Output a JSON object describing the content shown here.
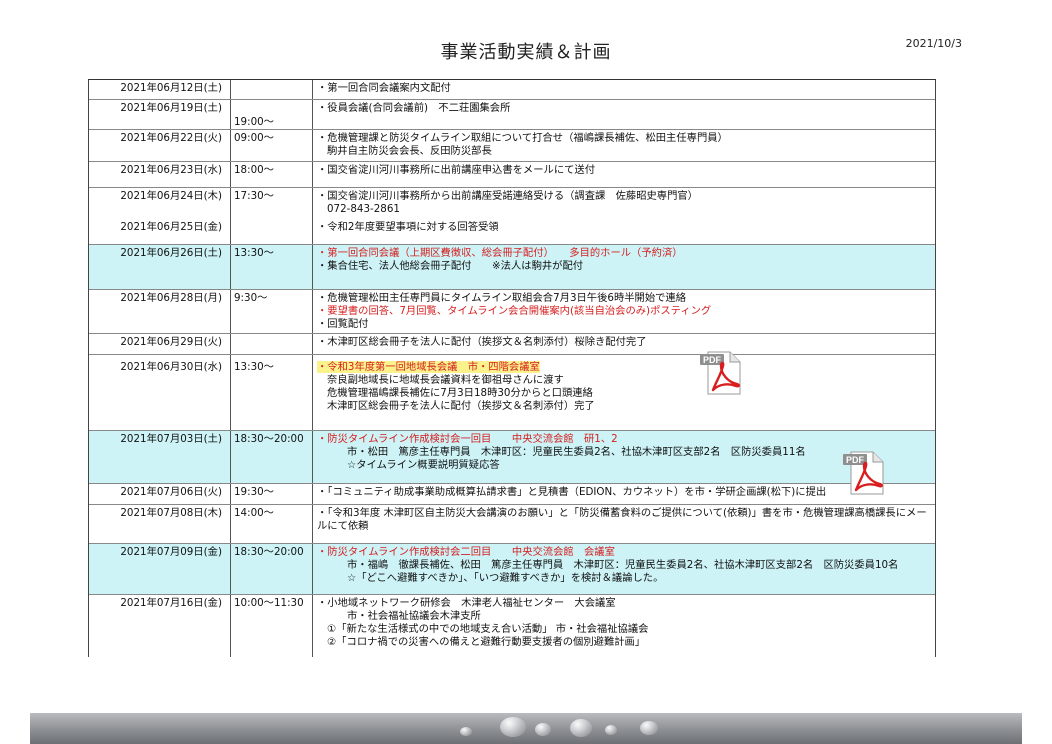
{
  "header": {
    "title": "事業活動実績＆計画",
    "date": "2021/10/3"
  },
  "rows": [
    {
      "date": "2021年06月12日(土)",
      "time": "",
      "lines": [
        "・第一回合同会議案内文配付"
      ]
    },
    {
      "date": "2021年06月19日(土)",
      "time": "19:00～",
      "lines": [
        "・役員会議(合同会議前)　不二荘園集会所"
      ]
    },
    {
      "date": "2021年06月22日(火)",
      "time": "09:00～",
      "lines": [
        "・危機管理課と防災タイムライン取組について打合せ（福嶋課長補佐、松田主任専門員）",
        "駒井自主防災会会長、反田防災部長"
      ]
    },
    {
      "date": "2021年06月23日(水)",
      "time": "18:00～",
      "lines": [
        "・国交省淀川河川事務所に出前講座申込書をメールにて送付"
      ]
    },
    {
      "date": "2021年06月24日(木)",
      "time": "17:30～",
      "lines": [
        "・国交省淀川河川事務所から出前講座受諾連絡受ける（調査課　佐藤昭史専門官）",
        "072-843-2861"
      ]
    },
    {
      "date": "2021年06月25日(金)",
      "time": "",
      "lines": [
        "・令和2年度要望事項に対する回答受領"
      ]
    },
    {
      "date": "2021年06月26日(土)",
      "time": "13:30～",
      "lines": [
        "・第一回合同会議（上期区費徴収、総会冊子配付）　　多目的ホール（予約済）",
        "・集合住宅、法人他総会冊子配付　　※法人は駒井が配付"
      ]
    },
    {
      "date": "2021年06月28日(月)",
      "time": "9:30～",
      "lines": [
        "・危機管理松田主任専門員にタイムライン取組会合7月3日午後6時半開始で連絡",
        "・要望書の回答、7月回覧、タイムライン会合開催案内(該当自治会のみ)ポスティング",
        "・回覧配付"
      ]
    },
    {
      "date": "2021年06月29日(火)",
      "time": "",
      "lines": [
        "・木津町区総会冊子を法人に配付（挨拶文＆名刺添付）桜除き配付完了"
      ]
    },
    {
      "date": "2021年06月30日(水)",
      "time": "13:30～",
      "lines": [
        "・令和3年度第一回地域長会議　市・四階会議室",
        "奈良副地域長に地域長会議資料を御祖母さんに渡す",
        "危機管理福嶋課長補佐に7月3日18時30分からと口頭連絡",
        "木津町区総会冊子を法人に配付（挨拶文＆名刺添付）完了"
      ]
    },
    {
      "date": "2021年07月03日(土)",
      "time": "18:30～20:00",
      "lines": [
        "・防災タイムライン作成検討会一回目　　中央交流会館　研1、2",
        "市・松田　篤彦主任専門員　木津町区：児童民生委員2名、社協木津町区支部2名　区防災委員11名",
        "☆タイムライン概要説明質疑応答"
      ]
    },
    {
      "date": "2021年07月06日(火)",
      "time": "19:30～",
      "lines": [
        "・「コミュニティ助成事業助成概算払請求書」と見積書（EDION、カウネット）を市・学研企画課(松下)に提出"
      ]
    },
    {
      "date": "2021年07月08日(木)",
      "time": "14:00～",
      "lines": [
        "・「令和3年度 木津町区自主防災大会講演のお願い」と「防災備蓄食料のご提供について(依頼)」書を市・危機管理課高橋課長にメールにて依頼"
      ]
    },
    {
      "date": "2021年07月09日(金)",
      "time": "18:30～20:00",
      "lines": [
        "・防災タイムライン作成検討会二回目　　中央交流会館　会議室",
        "市・福嶋　徹課長補佐、松田　篤彦主任専門員　木津町区：児童民生委員2名、社協木津町区支部2名　区防災委員10名",
        "☆「どこへ避難すべきか」、「いつ避難すべきか」を検討＆議論した。"
      ]
    },
    {
      "date": "2021年07月16日(金)",
      "time": "10:00～11:30",
      "lines": [
        "・小地域ネットワーク研修会　木津老人福祉センター　大会議室",
        "市・社会福祉協議会木津支所",
        "①「新たな生活様式の中での地域支え合い活動」 市・社会福祉協議会",
        "②「コロナ禍での災害への備えと避難行動要支援者の個別避難計画」"
      ]
    }
  ],
  "attachments": [
    {
      "icon": "pdf-file-icon",
      "label": "PDF"
    },
    {
      "icon": "pdf-file-icon",
      "label": "PDF"
    }
  ],
  "colors": {
    "highlight_row": "#cdf3f7",
    "red_text": "#d61f1f",
    "yellow_marker": "#fbf28c",
    "pdf_red": "#d81e1e"
  }
}
